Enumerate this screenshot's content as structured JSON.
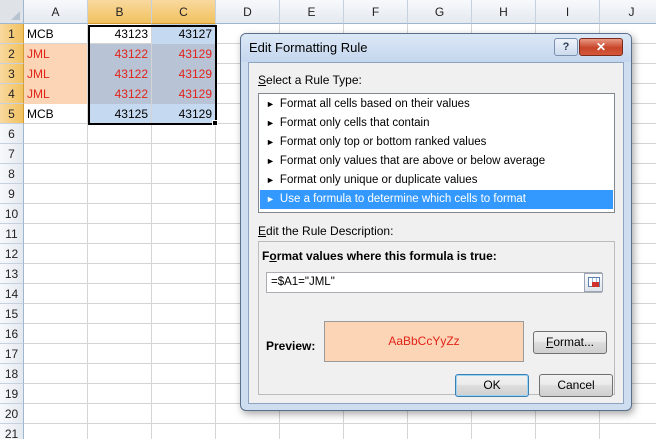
{
  "sheet": {
    "columns": [
      "A",
      "B",
      "C",
      "D",
      "E",
      "F",
      "G",
      "H",
      "I",
      "J"
    ],
    "rows": [
      "1",
      "2",
      "3",
      "4",
      "5",
      "6",
      "7",
      "8",
      "9",
      "10",
      "11",
      "12",
      "13",
      "14",
      "15",
      "16",
      "17",
      "18",
      "19",
      "20",
      "21"
    ],
    "data": [
      {
        "a": "MCB",
        "b": "43123",
        "c": "43127"
      },
      {
        "a": "JML",
        "b": "43122",
        "c": "43129"
      },
      {
        "a": "JML",
        "b": "43122",
        "c": "43129"
      },
      {
        "a": "JML",
        "b": "43122",
        "c": "43129"
      },
      {
        "a": "MCB",
        "b": "43125",
        "c": "43129"
      }
    ],
    "colors": {
      "highlight_fill": "#fbd5b5",
      "highlight_text": "#e2231a",
      "selection_fill": "#c5d9f1"
    }
  },
  "dialog": {
    "title": "Edit Formatting Rule",
    "help_glyph": "?",
    "close_glyph": "✕",
    "select_type_label_key": "S",
    "select_type_label_rest": "elect a Rule Type:",
    "rule_types": [
      "Format all cells based on their values",
      "Format only cells that contain",
      "Format only top or bottom ranked values",
      "Format only values that are above or below average",
      "Format only unique or duplicate values",
      "Use a formula to determine which cells to format"
    ],
    "selected_rule_index": 5,
    "arrow_glyph": "►",
    "edit_desc_label_key": "E",
    "edit_desc_label_rest": "dit the Rule Description:",
    "formula_title_key": "o",
    "formula_title_pre": "F",
    "formula_title_rest": "rmat values where this formula is true:",
    "formula_value": "=$A1=\"JML\"",
    "preview_label": "Preview:",
    "preview_text": "AaBbCcYyZz",
    "format_button_key": "F",
    "format_button_rest": "ormat...",
    "ok_label": "OK",
    "cancel_label": "Cancel"
  }
}
